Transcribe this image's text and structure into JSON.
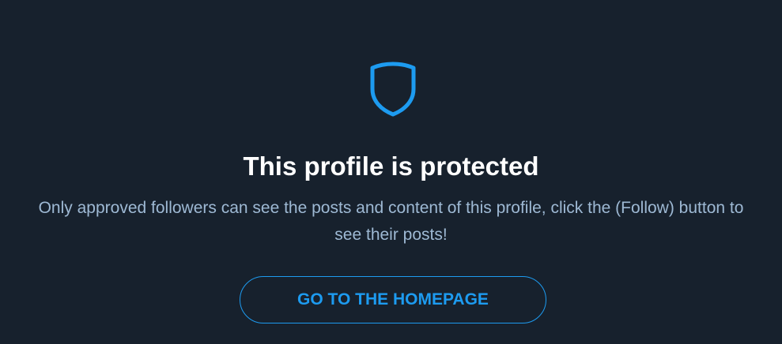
{
  "protected_notice": {
    "icon": "shield-icon",
    "title": "This profile is protected",
    "message": "Only approved followers can see the posts and content of this profile, click the (Follow) button to see their posts!",
    "button_label": "GO TO THE HOMEPAGE"
  },
  "colors": {
    "background": "#17212d",
    "accent": "#1d9bf0",
    "title": "#ffffff",
    "message": "#9eb9d4"
  }
}
